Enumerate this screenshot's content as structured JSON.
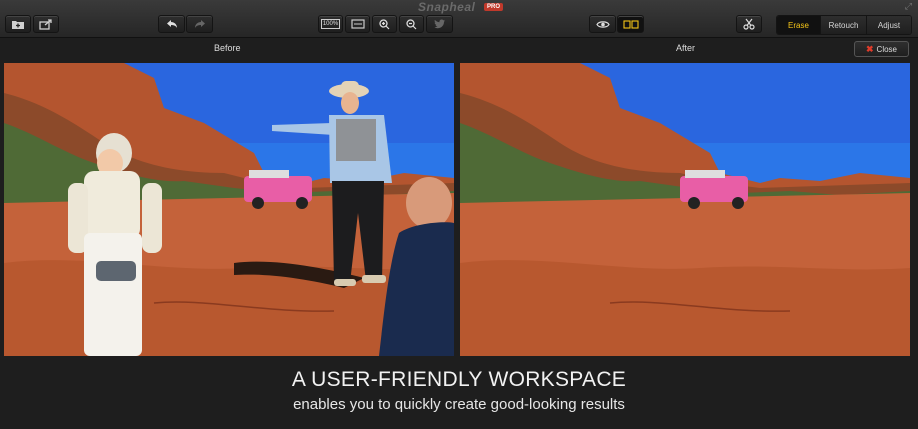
{
  "app": {
    "title": "Snapheal",
    "badge": "PRO"
  },
  "toolbar": {
    "zoom_100_label": "100%",
    "modes": [
      {
        "label": "Erase",
        "active": true
      },
      {
        "label": "Retouch",
        "active": false
      },
      {
        "label": "Adjust",
        "active": false
      }
    ]
  },
  "panes": {
    "before_label": "Before",
    "after_label": "After"
  },
  "close_button": {
    "label": "Close"
  },
  "banner": {
    "headline": "A USER-FRIENDLY WORKSPACE",
    "subline": "enables you to quickly create good-looking results"
  },
  "icons": [
    "add-image-icon",
    "share-icon",
    "undo-icon",
    "redo-icon",
    "zoom-100-icon",
    "fit-screen-icon",
    "zoom-in-icon",
    "zoom-out-icon",
    "twitter-icon",
    "preview-eye-icon",
    "compare-split-icon",
    "scissors-icon",
    "resize-icon",
    "close-icon"
  ],
  "colors": {
    "accent": "#f5c518",
    "close_x": "#e03b2a",
    "badge": "#c0392b"
  }
}
